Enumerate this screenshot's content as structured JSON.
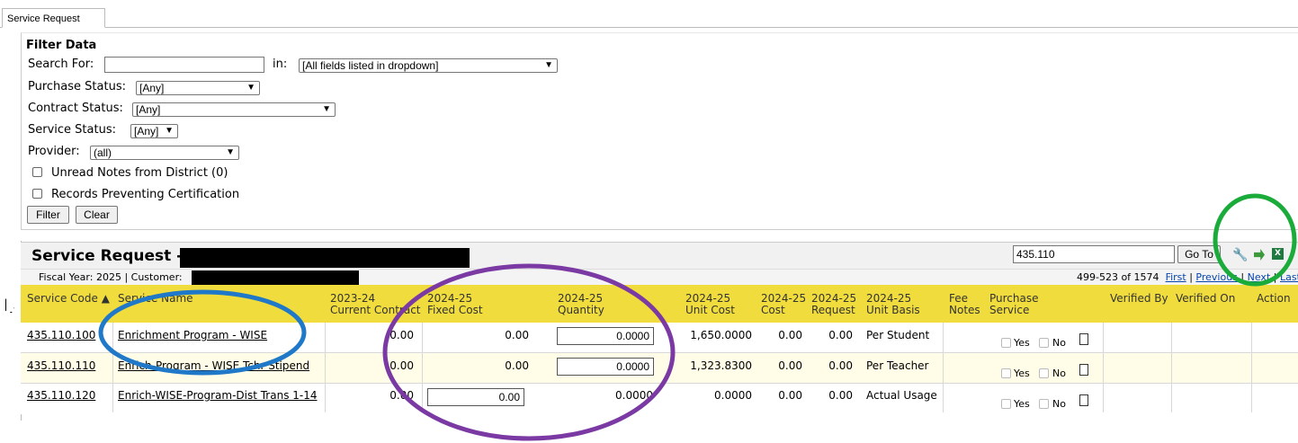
{
  "tab": {
    "label": "Service Request"
  },
  "filter": {
    "title": "Filter Data",
    "search_label": "Search For:",
    "search_value": "",
    "in_label": "in:",
    "in_select": "[All fields listed in dropdown]",
    "purchase_status_label": "Purchase Status:",
    "purchase_status_value": "[Any]",
    "contract_status_label": "Contract Status:",
    "contract_status_value": "[Any]",
    "service_status_label": "Service Status:",
    "service_status_value": "[Any]",
    "provider_label": "Provider:",
    "provider_value": "(all)",
    "unread_notes_label": "Unread Notes from District (0)",
    "records_preventing_label": "Records Preventing Certification",
    "filter_button": "Filter",
    "clear_button": "Clear"
  },
  "grid": {
    "title": "Service Request -",
    "goto_value": "435.110",
    "goto_button": "Go To",
    "fiscal_year": "Fiscal Year: 2025",
    "customer_label": "Customer:",
    "range_text": "499-523 of 1574",
    "nav": {
      "first": "First",
      "previous": "Previous",
      "next": "Next",
      "last": "Last"
    },
    "columns": {
      "service_code": "Service Code ▲",
      "service_name": "Service Name",
      "current_contract_1": "2023-24",
      "current_contract_2": "Current Contract",
      "fixed_cost_1": "2024-25",
      "fixed_cost_2": "Fixed Cost",
      "quantity_1": "2024-25",
      "quantity_2": "Quantity",
      "unit_cost_1": "2024-25",
      "unit_cost_2": "Unit Cost",
      "cost_1": "2024-25",
      "cost_2": "Cost",
      "request_1": "2024-25",
      "request_2": "Request",
      "unit_basis_1": "2024-25",
      "unit_basis_2": "Unit Basis",
      "fee_notes_1": "Fee",
      "fee_notes_2": "Notes",
      "purchase_service_1": "Purchase",
      "purchase_service_2": "Service",
      "verified_by": "Verified By",
      "verified_on": "Verified On",
      "action": "Action"
    },
    "rows": [
      {
        "code": "435.110.100",
        "name": "Enrichment Program - WISE",
        "current": "0.00",
        "fixed": "0.00",
        "quantity": "0.0000",
        "unit_cost": "1,650.0000",
        "cost": "0.00",
        "request": "0.00",
        "basis": "Per Student",
        "yes": "Yes",
        "no": "No"
      },
      {
        "code": "435.110.110",
        "name": "Enrich-Program - WISE Tchr Stipend",
        "current": "0.00",
        "fixed": "0.00",
        "quantity": "0.0000",
        "unit_cost": "1,323.8300",
        "cost": "0.00",
        "request": "0.00",
        "basis": "Per Teacher",
        "yes": "Yes",
        "no": "No"
      },
      {
        "code": "435.110.120",
        "name": "Enrich-WISE-Program-Dist Trans 1-14",
        "current": "0.00",
        "fixed": "0.00",
        "quantity": "0.0000",
        "unit_cost": "0.0000",
        "cost": "0.00",
        "request": "0.00",
        "basis": "Actual Usage",
        "yes": "Yes",
        "no": "No"
      }
    ]
  },
  "annotations": {
    "blue": "#1f78c8",
    "purple": "#7b3aa3",
    "green": "#1aab3a"
  }
}
